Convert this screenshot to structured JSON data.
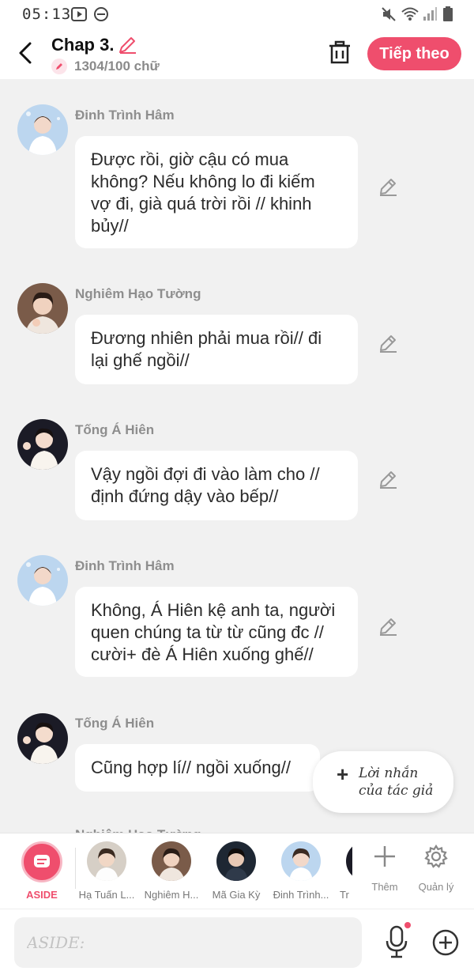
{
  "status_bar": {
    "time": "05:13",
    "icons": [
      "play-box-icon",
      "do-not-disturb-icon",
      "mute-icon",
      "wifi-icon",
      "signal-icon",
      "battery-icon"
    ]
  },
  "header": {
    "title": "Chap 3.",
    "word_count": "1304/100 chữ",
    "next_label": "Tiếp theo",
    "accent_color": "#ef4e6d"
  },
  "messages": [
    {
      "name": "Đinh Trình Hâm",
      "lines": [
        "Được rồi, giờ cậu có mua",
        "không? Nếu không lo đi kiếm",
        "vợ đi, già quá trời rồi // khinh",
        "bủy//"
      ]
    },
    {
      "name": "Nghiêm Hạo Tường",
      "lines": [
        "Đương nhiên phải mua rồi// đi",
        "lại ghế ngồi//"
      ]
    },
    {
      "name": "Tống Á Hiên",
      "lines": [
        "Vậy ngồi đợi đi vào làm cho //",
        "định đứng dậy vào bếp//"
      ]
    },
    {
      "name": "Đinh Trình Hâm",
      "lines": [
        "Không, Á Hiên kệ anh ta, người",
        "quen chúng ta từ từ cũng đc //",
        "cười+ đè Á Hiên xuống ghế//"
      ]
    },
    {
      "name": "Tống Á Hiên",
      "lines": [
        "Cũng hợp lí// ngồi xuống//"
      ]
    }
  ],
  "peek_name": "Nghiêm Hạo Tường",
  "author_note": {
    "line1": "Lời nhắn",
    "line2": "của tác giả"
  },
  "character_bar": {
    "aside_label": "ASIDE",
    "characters": [
      "Hạ Tuấn L...",
      "Nghiêm H...",
      "Mã Gia Kỳ",
      "Đinh Trình...",
      "Tr"
    ],
    "add_label": "Thêm",
    "manage_label": "Quản lý"
  },
  "input": {
    "placeholder": "ASIDE:"
  }
}
